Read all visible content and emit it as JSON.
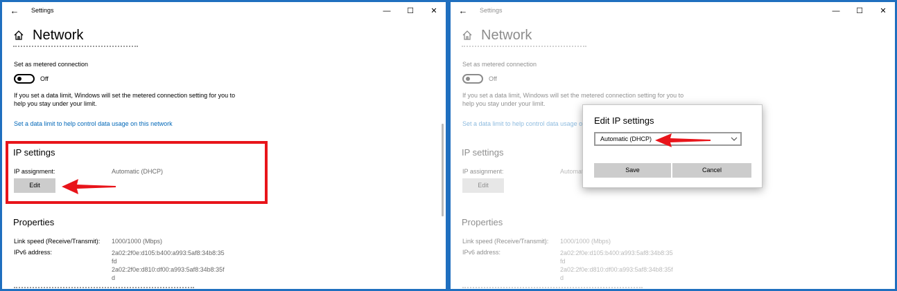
{
  "window": {
    "title": "Settings",
    "back_glyph": "←",
    "minimize_glyph": "—",
    "maximize_glyph": "☐",
    "close_glyph": "✕"
  },
  "page": {
    "title": "Network"
  },
  "metered": {
    "label": "Set as metered connection",
    "toggle_state": "Off",
    "info": "If you set a data limit, Windows will set the metered connection setting for you to help you stay under your limit.",
    "link": "Set a data limit to help control data usage on this network"
  },
  "ip": {
    "heading": "IP settings",
    "assignment_label": "IP assignment:",
    "assignment_value": "Automatic (DHCP)",
    "edit_label": "Edit"
  },
  "properties": {
    "heading": "Properties",
    "speed_label": "Link speed (Receive/Transmit):",
    "speed_value": "1000/1000 (Mbps)",
    "ipv6_label": "IPv6 address:",
    "ipv6_value1": "2a02:2f0e:d105:b400:a993:5af8:34b8:35fd",
    "ipv6_value2": "2a02:2f0e:d810:df00:a993:5af8:34b8:35fd"
  },
  "dialog": {
    "title": "Edit IP settings",
    "selected": "Automatic (DHCP)",
    "save_label": "Save",
    "cancel_label": "Cancel"
  },
  "colors": {
    "annotation_red": "#e8141a",
    "link_blue": "#0067b8",
    "desktop_blue": "#1f6fbf"
  },
  "icons": {
    "back": "back-arrow-icon",
    "home": "home-icon",
    "chevron": "chevron-down-icon"
  }
}
